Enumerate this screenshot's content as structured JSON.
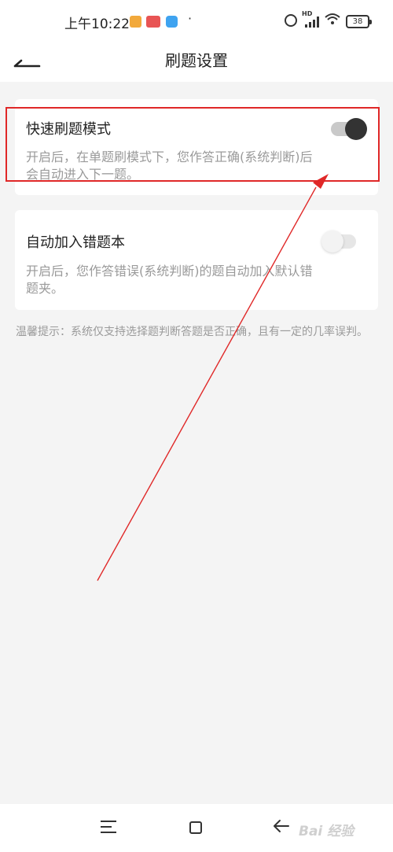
{
  "status_bar": {
    "time": "上午10:22",
    "dot": "·",
    "hd_label": "HD",
    "battery": "38"
  },
  "header": {
    "title": "刷题设置"
  },
  "settings": [
    {
      "title": "快速刷题模式",
      "description": "开启后，在单题刷模式下，您作答正确(系统判断)后会自动进入下一题。",
      "enabled": true
    },
    {
      "title": "自动加入错题本",
      "description": "开启后，您作答错误(系统判断)的题自动加入默认错题夹。",
      "enabled": false
    }
  ],
  "tip": "温馨提示：系统仅支持选择题判断答题是否正确，且有一定的几率误判。",
  "watermark": "Bai 经验",
  "colors": {
    "highlight": "#e02828",
    "toggle_on_knob": "#333333",
    "background": "#f4f4f4"
  }
}
